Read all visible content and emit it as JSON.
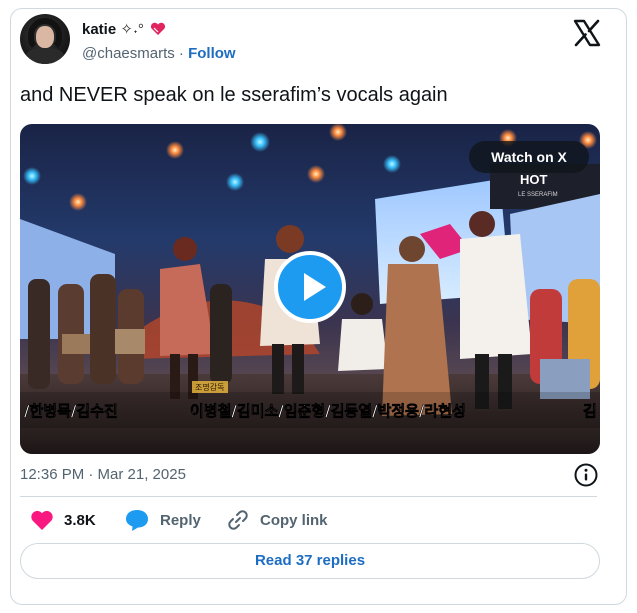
{
  "author": {
    "display_name": "katie",
    "name_decoration": " ✧˖°",
    "handle": "@chaesmarts",
    "separator": " · ",
    "follow_label": "Follow"
  },
  "tweet": {
    "text": "and NEVER speak on le sserafim’s vocals again",
    "timestamp": "12:36 PM · Mar 21, 2025"
  },
  "media": {
    "watch_label": "Watch on X",
    "screen_text_top": "HOT",
    "screen_text_sub": "LE SSERAFIM",
    "caption_small": "조명감독",
    "caption_left": "/한병목/김수진",
    "caption_main": "이병철/김미소/임준형/김동열/박정용/라현성",
    "caption_right": "김"
  },
  "actions": {
    "like_count": "3.8K",
    "reply_label": "Reply",
    "copy_label": "Copy link",
    "read_replies_label": "Read 37 replies"
  },
  "colors": {
    "like": "#f91880",
    "reply": "#1d9bf0",
    "link_blue": "#1d6ec2",
    "border": "#cfd9de",
    "muted": "#536471"
  }
}
